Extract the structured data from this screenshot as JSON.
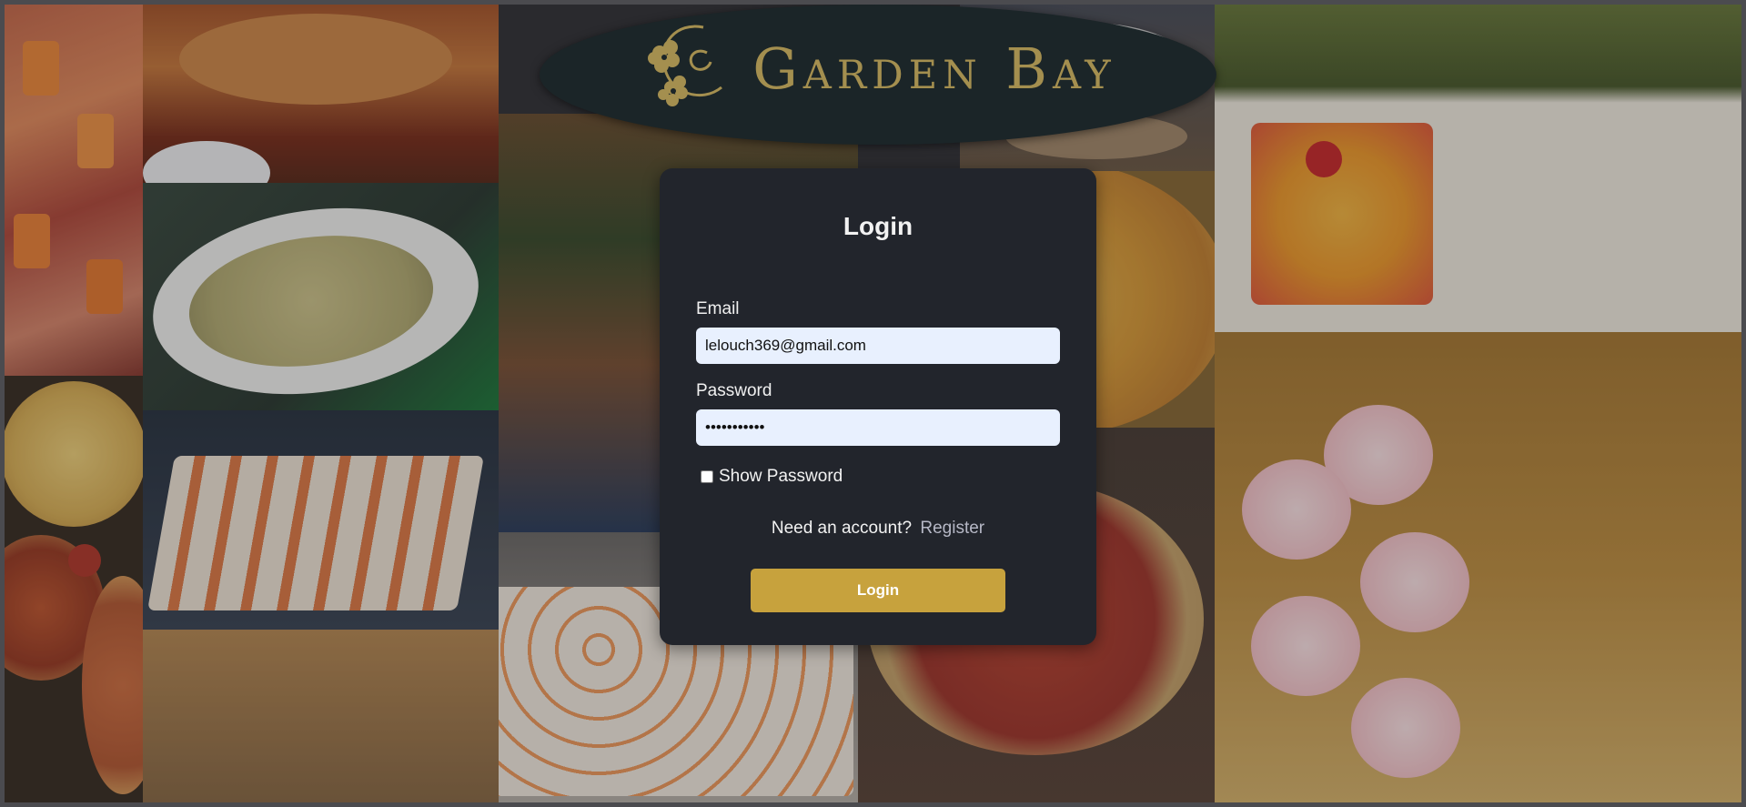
{
  "brand": {
    "name": "Garden Bay",
    "logo_color": "#a48f4f",
    "logo_icon": "flower-icon"
  },
  "login": {
    "title": "Login",
    "email_label": "Email",
    "email_value": "lelouch369@gmail.com",
    "password_label": "Password",
    "password_value": "password123",
    "show_password_label": "Show Password",
    "show_password_checked": false,
    "need_account_text": "Need an account?",
    "register_link": "Register",
    "submit_label": "Login"
  },
  "colors": {
    "card_bg": "#22252c",
    "button_bg": "#c7a23d",
    "input_bg": "#e8f0fe",
    "link": "#b6b8c6"
  }
}
